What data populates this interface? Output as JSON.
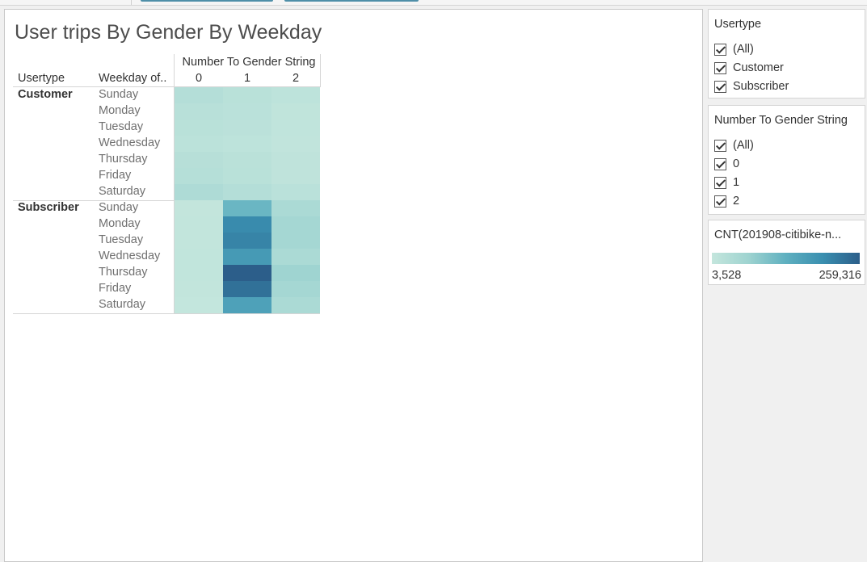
{
  "chart_data": {
    "type": "heatmap",
    "title": "User trips By Gender By Weekday",
    "row_header": "Usertype",
    "sub_row_header": "Weekday of..",
    "column_header": "Number To Gender String",
    "columns": [
      "0",
      "1",
      "2"
    ],
    "groups": [
      {
        "usertype": "Customer",
        "days": [
          "Sunday",
          "Monday",
          "Tuesday",
          "Wednesday",
          "Thursday",
          "Friday",
          "Saturday"
        ],
        "values": [
          [
            30000,
            22000,
            15000
          ],
          [
            24000,
            20000,
            11000
          ],
          [
            22000,
            19000,
            10000
          ],
          [
            18000,
            15000,
            9000
          ],
          [
            26000,
            21000,
            12000
          ],
          [
            28000,
            22000,
            12000
          ],
          [
            40000,
            30000,
            20000
          ]
        ]
      },
      {
        "usertype": "Subscriber",
        "days": [
          "Sunday",
          "Monday",
          "Tuesday",
          "Wednesday",
          "Thursday",
          "Friday",
          "Saturday"
        ],
        "values": [
          [
            6000,
            120000,
            45000
          ],
          [
            7000,
            200000,
            55000
          ],
          [
            7000,
            210000,
            55000
          ],
          [
            8000,
            175000,
            45000
          ],
          [
            8000,
            259316,
            65000
          ],
          [
            7000,
            235000,
            55000
          ],
          [
            5000,
            160000,
            45000
          ]
        ]
      }
    ],
    "color_min": 3528,
    "color_max": 259316
  },
  "filters": [
    {
      "title": "Usertype",
      "items": [
        "(All)",
        "Customer",
        "Subscriber"
      ]
    },
    {
      "title": "Number To Gender String",
      "items": [
        "(All)",
        "0",
        "1",
        "2"
      ]
    }
  ],
  "legend": {
    "title": "CNT(201908-citibike-n...",
    "min_label": "3,528",
    "max_label": "259,316",
    "color_stops": [
      "#c4e6dd",
      "#9ed3d0",
      "#5fb0c0",
      "#3a8fb0",
      "#2c5e8a"
    ]
  }
}
